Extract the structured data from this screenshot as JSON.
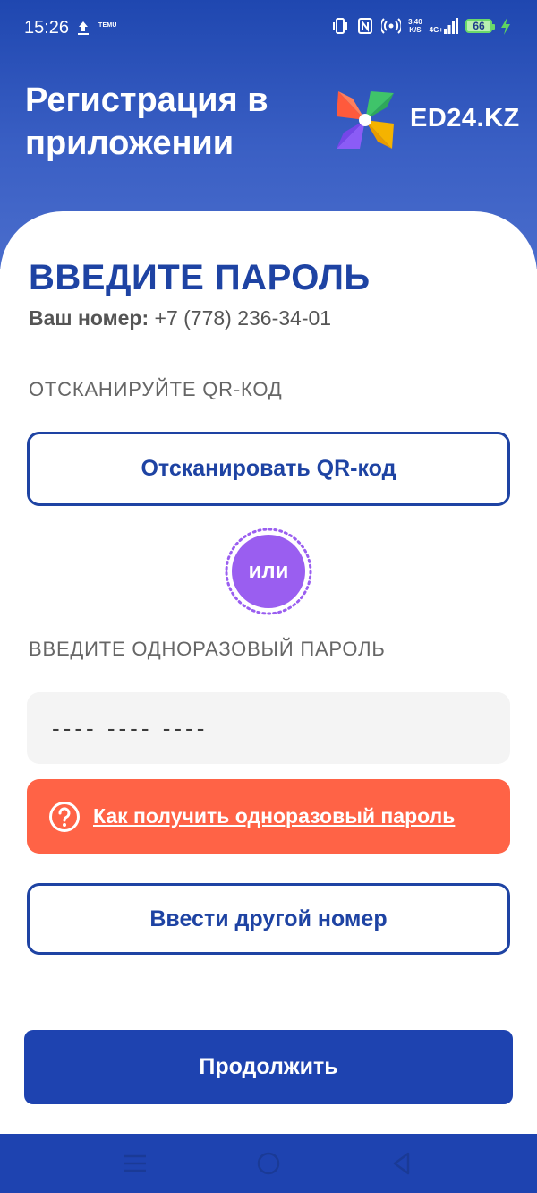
{
  "status_bar": {
    "time": "15:26",
    "temu_label_top": "",
    "temu_label": "TEMU",
    "network_speed_value": "3,40",
    "network_speed_unit": "K/S",
    "network_type": "4G+",
    "battery_level": "66"
  },
  "header": {
    "title": "Регистрация в приложении",
    "logo_text": "ED24.KZ"
  },
  "main": {
    "page_title": "ВВЕДИТЕ ПАРОЛЬ",
    "phone_label": "Ваш номер:",
    "phone_number": "+7 (778) 236-34-01",
    "qr_section_label": "ОТСКАНИРУЙТЕ QR-КОД",
    "scan_qr_button": "Отсканировать QR-код",
    "or_label": "или",
    "otp_section_label": "ВВЕДИТЕ ОДНОРАЗОВЫЙ ПАРОЛЬ",
    "otp_placeholder": "---- ---- ----",
    "help_link": "Как получить одноразовый пароль",
    "other_number_button": "Ввести другой номер",
    "continue_button": "Продолжить"
  },
  "colors": {
    "brand_blue": "#1e43a3",
    "header_gradient_top": "#1f47b0",
    "header_gradient_bottom": "#4a6dcc",
    "help_orange": "#ff6346",
    "or_badge_purple": "#9a5ef0",
    "input_background": "#f4f4f4"
  },
  "icons": {
    "upload": "upload-arrow-icon",
    "vibrate": "vibrate-icon",
    "nfc": "nfc-icon",
    "hotspot": "hotspot-icon",
    "signal": "signal-bars-icon",
    "charging": "charging-bolt-icon",
    "logo": "pinwheel-logo-icon",
    "help": "question-circle-icon",
    "nav_menu": "menu-lines-icon",
    "nav_home": "home-circle-icon",
    "nav_back": "back-triangle-icon"
  }
}
